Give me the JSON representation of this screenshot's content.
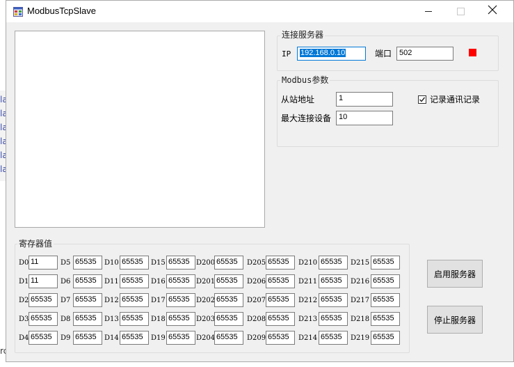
{
  "window": {
    "title": "ModbusTcpSlave"
  },
  "background_fragments": [
    "la",
    "la",
    "la",
    "la",
    "la",
    "la",
    "rc"
  ],
  "server_group": {
    "legend": "连接服务器",
    "ip_label": "IP",
    "ip_value": "192.168.0.10",
    "port_label": "端口",
    "port_value": "502",
    "status_color": "#ff0000"
  },
  "params_group": {
    "legend": "Modbus参数",
    "slave_addr_label": "从站地址",
    "slave_addr_value": "1",
    "max_conn_label": "最大连接设备",
    "max_conn_value": "10",
    "log_checkbox_label": "记录通讯记录",
    "log_checked": true
  },
  "registers_group": {
    "legend": "寄存器值",
    "columns": [
      {
        "labels": [
          "D0",
          "D1",
          "D2",
          "D3",
          "D4"
        ],
        "values": [
          "11",
          "11",
          "65535",
          "65535",
          "65535"
        ]
      },
      {
        "labels": [
          "D5",
          "D6",
          "D7",
          "D8",
          "D9"
        ],
        "values": [
          "65535",
          "65535",
          "65535",
          "65535",
          "65535"
        ]
      },
      {
        "labels": [
          "D10",
          "D11",
          "D12",
          "D13",
          "D14"
        ],
        "values": [
          "65535",
          "65535",
          "65535",
          "65535",
          "65535"
        ]
      },
      {
        "labels": [
          "D15",
          "D16",
          "D17",
          "D18",
          "D19"
        ],
        "values": [
          "65535",
          "65535",
          "65535",
          "65535",
          "65535"
        ]
      },
      {
        "labels": [
          "D200",
          "D201",
          "D202",
          "D203",
          "D204"
        ],
        "values": [
          "65535",
          "65535",
          "65535",
          "65535",
          "65535"
        ]
      },
      {
        "labels": [
          "D205",
          "D206",
          "D207",
          "D208",
          "D209"
        ],
        "values": [
          "65535",
          "65535",
          "65535",
          "65535",
          "65535"
        ]
      },
      {
        "labels": [
          "D210",
          "D211",
          "D212",
          "D213",
          "D214"
        ],
        "values": [
          "65535",
          "65535",
          "65535",
          "65535",
          "65535"
        ]
      },
      {
        "labels": [
          "D215",
          "D216",
          "D217",
          "D218",
          "D219"
        ],
        "values": [
          "65535",
          "65535",
          "65535",
          "65535",
          "65535"
        ]
      }
    ]
  },
  "buttons": {
    "start": "启用服务器",
    "stop": "停止服务器"
  }
}
